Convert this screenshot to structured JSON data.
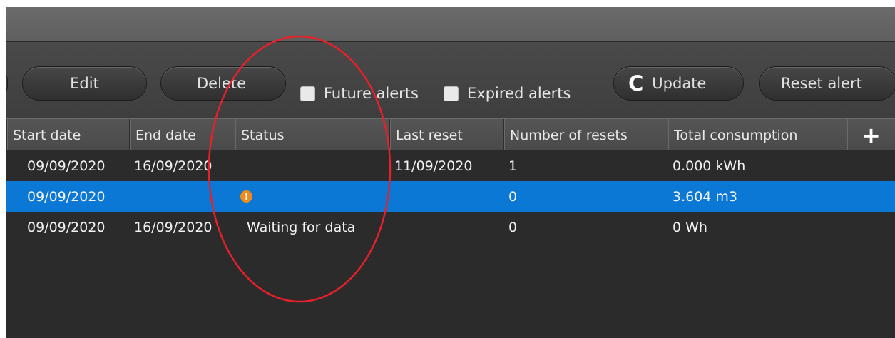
{
  "toolbar": {
    "edit_label": "Edit",
    "delete_label": "Delete",
    "future_alerts_label": "Future alerts",
    "expired_alerts_label": "Expired alerts",
    "update_label": "Update",
    "reset_alert_label": "Reset alert",
    "refresh_glyph": "C"
  },
  "grid": {
    "columns": [
      "Start date",
      "End date",
      "Status",
      "Last reset",
      "Number of resets",
      "Total consumption"
    ],
    "add_column_glyph": "+",
    "rows": [
      {
        "start": "09/09/2020",
        "end": "16/09/2020",
        "status": "",
        "last_reset": "11/09/2020",
        "resets": "1",
        "consumption": "0.000 kWh"
      },
      {
        "start": "09/09/2020",
        "end": "",
        "status": "",
        "status_icon": "warning-icon",
        "last_reset": "",
        "resets": "0",
        "consumption": "3.604 m3"
      },
      {
        "start": "09/09/2020",
        "end": "16/09/2020",
        "status": "Waiting for data",
        "last_reset": "",
        "resets": "0",
        "consumption": "0 Wh"
      }
    ],
    "selected_row": 1,
    "warning_glyph": "!"
  },
  "colors": {
    "selection": "#0a78d4",
    "warning": "#f08a1c",
    "annotation": "#e8202a"
  }
}
